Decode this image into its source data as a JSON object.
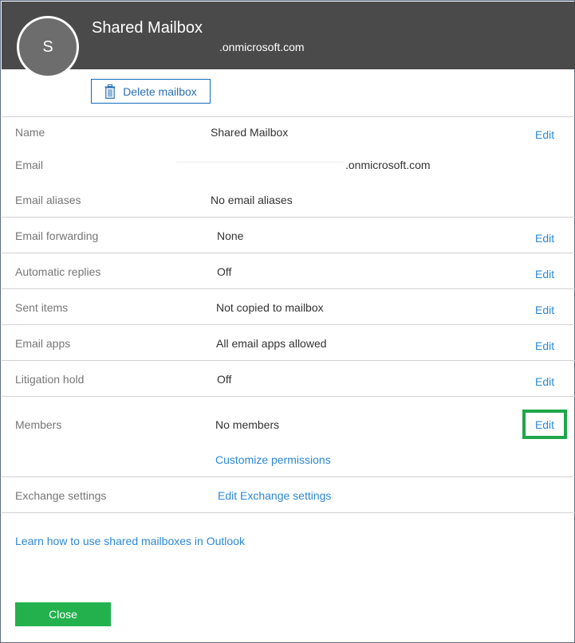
{
  "header": {
    "avatar_initial": "S",
    "title": "Shared Mailbox",
    "email_suffix": ".onmicrosoft.com"
  },
  "actions": {
    "delete_label": "Delete mailbox"
  },
  "fields": {
    "name": {
      "label": "Name",
      "value": "Shared Mailbox",
      "edit": "Edit"
    },
    "email": {
      "label": "Email",
      "value": ".onmicrosoft.com"
    },
    "aliases": {
      "label": "Email aliases",
      "value": "No email aliases"
    },
    "forwarding": {
      "label": "Email forwarding",
      "value": "None",
      "edit": "Edit"
    },
    "auto_replies": {
      "label": "Automatic replies",
      "value": "Off",
      "edit": "Edit"
    },
    "sent_items": {
      "label": "Sent items",
      "value": "Not copied to mailbox",
      "edit": "Edit"
    },
    "email_apps": {
      "label": "Email apps",
      "value": "All email apps allowed",
      "edit": "Edit"
    },
    "litigation": {
      "label": "Litigation hold",
      "value": "Off",
      "edit": "Edit"
    },
    "members": {
      "label": "Members",
      "value": "No members",
      "edit": "Edit",
      "customize": "Customize permissions"
    },
    "exchange": {
      "label": "Exchange settings",
      "link": "Edit Exchange settings"
    }
  },
  "learn_link": "Learn how to use shared mailboxes in Outlook",
  "close_label": "Close",
  "colors": {
    "header_bg": "#4a4a4a",
    "link": "#2b88d8",
    "close_bg": "#23b14d",
    "highlight": "#1fa64a"
  }
}
